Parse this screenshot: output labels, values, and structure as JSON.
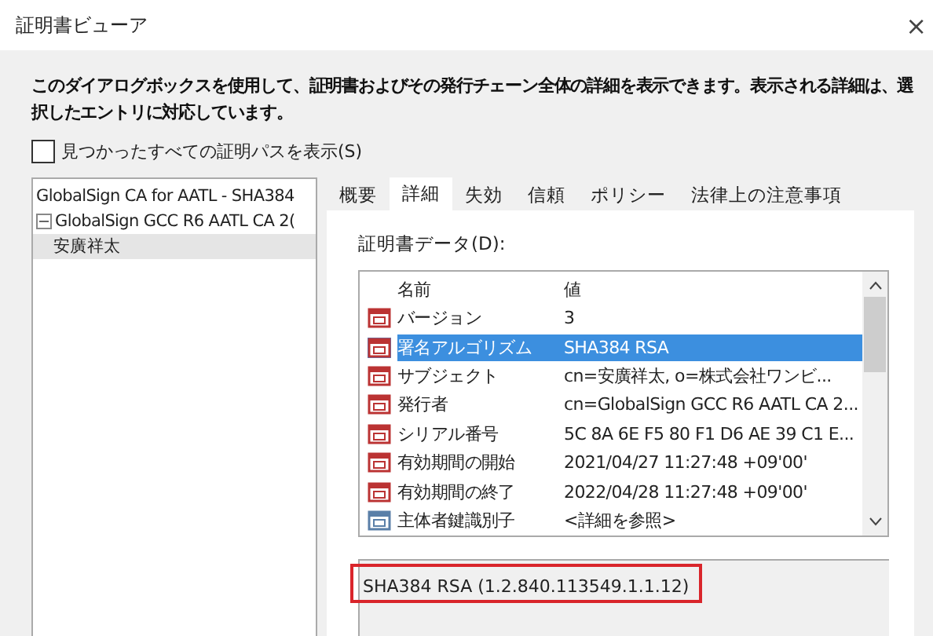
{
  "window": {
    "title": "証明書ビューア",
    "close": "×"
  },
  "intro": "このダイアログボックスを使用して、証明書およびその発行チェーン全体の詳細を表示できます。表示される詳細は、選択したエントリに対応しています。",
  "show_all_paths": {
    "label": "見つかったすべての証明パスを表示(S)",
    "checked": false
  },
  "tree": [
    {
      "label": "GlobalSign CA for AATL - SHA384",
      "selected": false,
      "children": [
        {
          "label": "GlobalSign GCC R6 AATL CA 2(",
          "selected": false,
          "expanded": true,
          "children": [
            {
              "label": "安廣祥太",
              "selected": true
            }
          ]
        }
      ]
    }
  ],
  "tabs": [
    {
      "label": "概要",
      "selected": false
    },
    {
      "label": "詳細",
      "selected": true
    },
    {
      "label": "失効",
      "selected": false
    },
    {
      "label": "信頼",
      "selected": false
    },
    {
      "label": "ポリシー",
      "selected": false
    },
    {
      "label": "法律上の注意事項",
      "selected": false
    }
  ],
  "data_label": "証明書データ(D):",
  "columns": [
    "名前",
    "値"
  ],
  "fields": [
    {
      "kind": "field",
      "name": "バージョン",
      "value": "3",
      "selected": false
    },
    {
      "kind": "field",
      "name": "署名アルゴリズム",
      "value": "SHA384 RSA",
      "selected": true
    },
    {
      "kind": "field",
      "name": "サブジェクト",
      "value": "cn=安廣祥太, o=株式会社ワンビ...",
      "selected": false
    },
    {
      "kind": "field",
      "name": "発行者",
      "value": "cn=GlobalSign GCC R6 AATL CA 2...",
      "selected": false
    },
    {
      "kind": "field",
      "name": "シリアル番号",
      "value": "5C 8A 6E F5 80 F1 D6 AE 39 C1 E...",
      "selected": false
    },
    {
      "kind": "field",
      "name": "有効期間の開始",
      "value": "2021/04/27 11:27:48 +09'00'",
      "selected": false
    },
    {
      "kind": "field",
      "name": "有効期間の終了",
      "value": "2022/04/28 11:27:48 +09'00'",
      "selected": false
    },
    {
      "kind": "extension",
      "name": "主体者鍵識別子",
      "value": "<詳細を参照>",
      "selected": false
    }
  ],
  "detail": {
    "text": "SHA384 RSA (1.2.840.113549.1.1.12)",
    "highlighted": true
  }
}
